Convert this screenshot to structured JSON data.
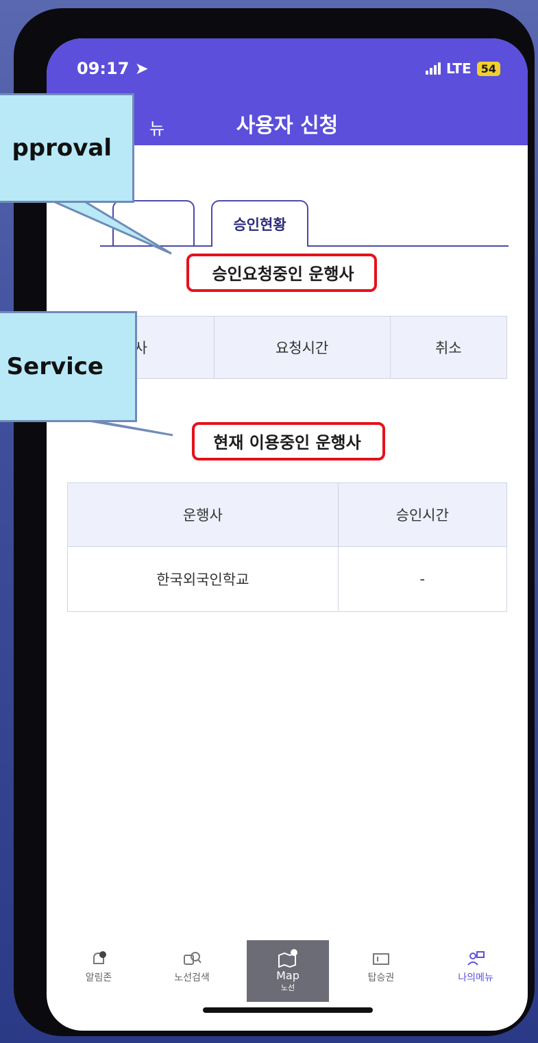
{
  "status": {
    "time": "09:17",
    "network": "LTE",
    "battery": "54"
  },
  "header": {
    "back_label": "뉴",
    "title": "사용자 신청"
  },
  "tabs": {
    "first": "",
    "active": "승인현황"
  },
  "pending": {
    "heading": "승인요청중인 운행사",
    "columns": [
      "사",
      "요청시간",
      "취소"
    ]
  },
  "current": {
    "heading": "현재 이용중인 운행사",
    "columns": [
      "운행사",
      "승인시간"
    ],
    "rows": [
      {
        "operator": "한국외국인학교",
        "approved_time": "-"
      }
    ]
  },
  "nav": {
    "items": [
      {
        "label": "알림존"
      },
      {
        "label": "노선검색"
      },
      {
        "label": "Map",
        "sub": "노선"
      },
      {
        "label": "탑승권"
      },
      {
        "label": "나의메뉴"
      }
    ]
  },
  "callouts": {
    "approval": "pproval",
    "service": "Service"
  },
  "colors": {
    "header": "#5b4fdc",
    "tab_accent": "#4b49a8",
    "highlight": "#e6111a",
    "callout_fill": "#b9e9f7",
    "nav_active": "#5b4fdc"
  }
}
